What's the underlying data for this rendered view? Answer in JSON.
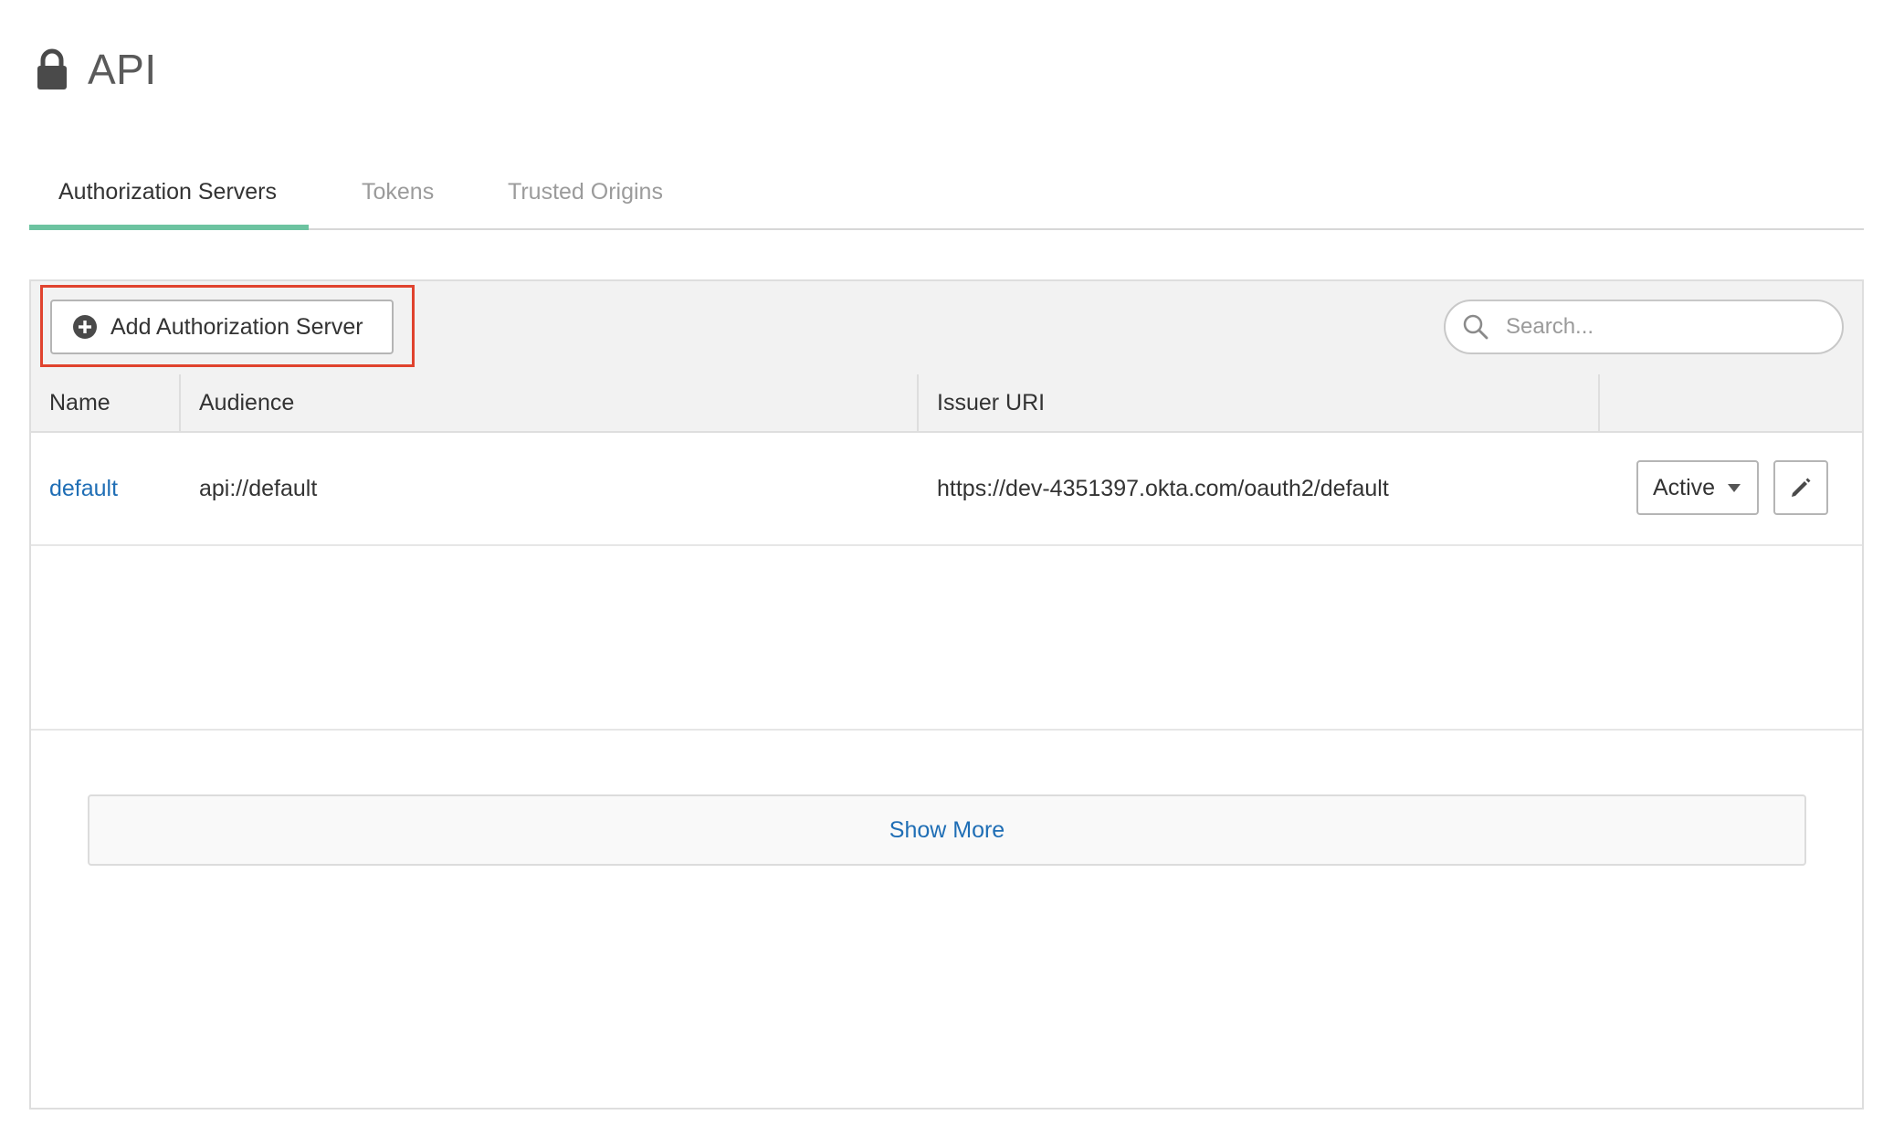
{
  "header": {
    "title": "API",
    "icon": "lock-icon"
  },
  "tabs": [
    {
      "label": "Authorization Servers",
      "active": true
    },
    {
      "label": "Tokens",
      "active": false
    },
    {
      "label": "Trusted Origins",
      "active": false
    }
  ],
  "toolbar": {
    "add_button_label": "Add Authorization Server",
    "add_button_icon": "plus-circle-icon",
    "search_placeholder": "Search..."
  },
  "table": {
    "columns": [
      "Name",
      "Audience",
      "Issuer URI",
      ""
    ],
    "rows": [
      {
        "name": "default",
        "audience": "api://default",
        "issuer_uri": "https://dev-4351397.okta.com/oauth2/default",
        "status": "Active"
      }
    ]
  },
  "show_more_label": "Show More",
  "colors": {
    "accent": "#6cc3a0",
    "link": "#1f6eb5",
    "highlight": "#e0432e"
  }
}
